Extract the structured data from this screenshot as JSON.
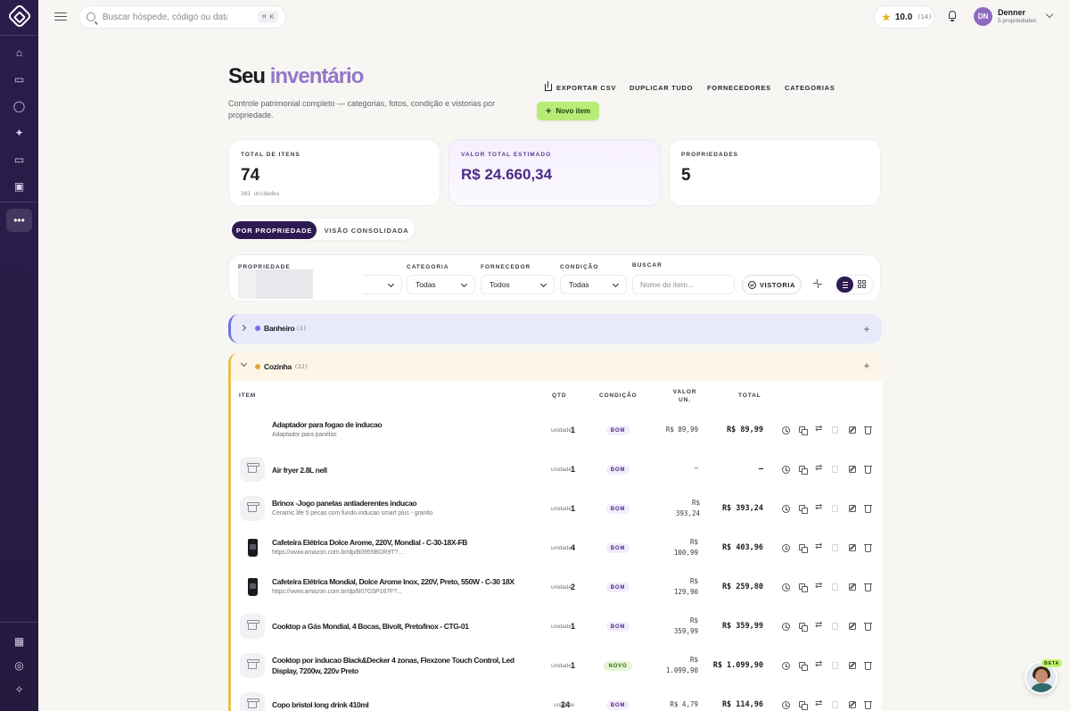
{
  "topbar": {
    "search_placeholder": "Buscar hóspede, código ou data",
    "search_shortcut": "⌘ K",
    "rating": "10.0",
    "rating_count": "(14)",
    "user_initials": "DN",
    "user_name": "Denner",
    "user_sub": "5 propriedades"
  },
  "header": {
    "title_part1": "Seu",
    "title_part2": "inventário",
    "subtitle": "Controle patrimonial completo — categorias, fotos, condição e vistorias por propriedade.",
    "actions": [
      "EXPORTAR CSV",
      "DUPLICAR TUDO",
      "FORNECEDORES",
      "CATEGORIAS"
    ],
    "new_item": "Novo item"
  },
  "stats": {
    "total_items_label": "TOTAL DE ITENS",
    "total_items": "74",
    "total_units": "302 unidades",
    "value_label": "VALOR TOTAL ESTIMADO",
    "value": "R$ 24.660,34",
    "properties_label": "PROPRIEDADES",
    "properties": "5"
  },
  "view_toggle": {
    "by_property": "POR PROPRIEDADE",
    "consolidated": "VISÃO CONSOLIDADA"
  },
  "filters": {
    "property_label": "PROPRIEDADE",
    "category_label": "CATEGORIA",
    "category_value": "Todas",
    "supplier_label": "FORNECEDOR",
    "supplier_value": "Todos",
    "condition_label": "CONDIÇÃO",
    "condition_value": "Todas",
    "search_label": "BUSCAR",
    "search_placeholder": "Nome do item...",
    "inspection": "VISTORIA"
  },
  "groups": [
    {
      "name": "Banheiro",
      "count": "(1)",
      "color": "#6f73df"
    },
    {
      "name": "Cozinha",
      "count": "(22)",
      "color": "#e7a53a"
    }
  ],
  "table": {
    "headers": {
      "item": "ITEM",
      "qty": "QTD",
      "condition": "CONDIÇÃO",
      "unit_value": "VALOR UN.",
      "total": "TOTAL"
    },
    "unit_word": "unidade",
    "rows": [
      {
        "name": "Adaptador para fogao de inducao",
        "desc": "Adaptador para panelas",
        "qty": "1",
        "cond": "BOM",
        "vun": "R$ 89,99",
        "total": "R$ 89,99"
      },
      {
        "name": "Air fryer 2.8L nell",
        "desc": "",
        "qty": "1",
        "cond": "BOM",
        "vun": "—",
        "total": "—"
      },
      {
        "name": "Brinox -Jogo panelas antiaderentes inducao",
        "desc": "Ceramic life 5 pecas com fundo inducao smart plus - granito",
        "qty": "1",
        "cond": "BOM",
        "vun": "R$ 393,24",
        "total": "R$ 393,24"
      },
      {
        "name": "Cafeteira Elétrica Dolce Arome, 220V, Mondial - C-30-18X-FB",
        "desc": "https://www.amazon.com.br/dp/B0955BGR9T?...",
        "qty": "4",
        "cond": "BOM",
        "vun": "R$ 100,99",
        "total": "R$ 403,96"
      },
      {
        "name": "Cafeteira Elétrica Mondial, Dolce Arome Inox, 220V, Preto, 550W - C-30 18X",
        "desc": "https://www.amazon.com.br/dp/B07G5P167F?...",
        "qty": "2",
        "cond": "BOM",
        "vun": "R$ 129,90",
        "total": "R$ 259,80"
      },
      {
        "name": "Cooktop a Gás Mondial, 4 Bocas, Bivolt, Preto/Inox - CTG-01",
        "desc": "",
        "qty": "1",
        "cond": "BOM",
        "vun": "R$ 359,99",
        "total": "R$ 359,99"
      },
      {
        "name": "Cooktop por inducao Black&Decker 4 zonas, Flexzone Touch Control, Led Display, 7200w, 220v Preto",
        "desc": "",
        "qty": "1",
        "cond": "NOVO",
        "vun": "R$ 1.099,90",
        "total": "R$ 1.099,90"
      },
      {
        "name": "Copo bristol long drink 410ml",
        "desc": "",
        "qty": "24",
        "cond": "BOM",
        "vun": "R$ 4,79",
        "total": "R$ 114,96"
      }
    ]
  },
  "chat": {
    "badge": "BETA"
  }
}
